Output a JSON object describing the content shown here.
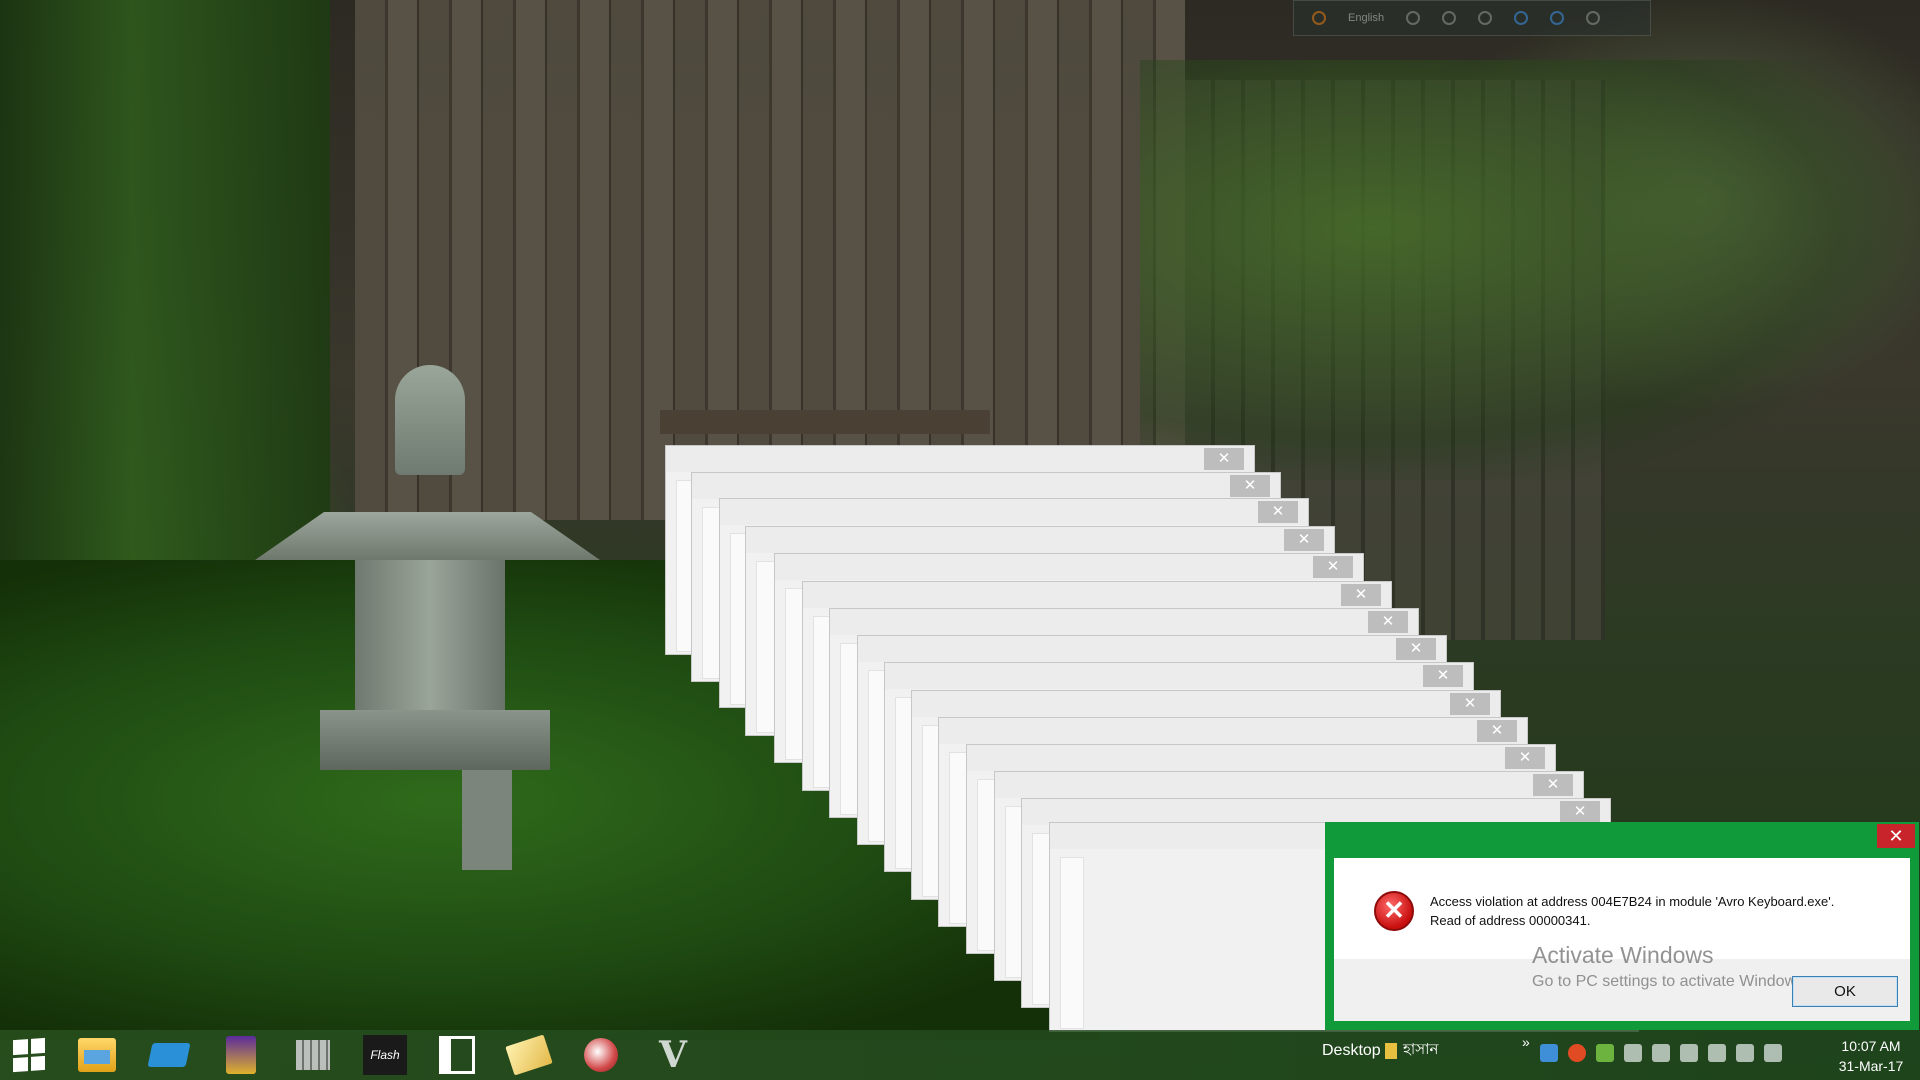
{
  "language_bar": {
    "language": "English",
    "icons": [
      "avro-logo-icon",
      "keyboard-layout-icon",
      "tools-icon",
      "settings-icon",
      "web-icon",
      "help-icon",
      "info-icon"
    ]
  },
  "ghost_dialogs": {
    "close_glyph": "✕",
    "count": 16
  },
  "error_dialog": {
    "close_glyph": "✕",
    "icon": "error-x-icon",
    "icon_glyph": "✕",
    "message_line1": "Access violation at address 004E7B24 in module 'Avro Keyboard.exe'.",
    "message_line2": "Read of address 00000341.",
    "ok_label": "OK",
    "title_color": "#109a3a"
  },
  "watermark": {
    "line1": "Activate Windows",
    "line2": "Go to PC settings to activate Windows."
  },
  "taskbar": {
    "start_icon": "windows-start-icon",
    "pinned": [
      "file-explorer-icon",
      "calculator-icon",
      "dictionary-app-icon",
      "grid-app-icon",
      "flash-icon",
      "reader-app-icon",
      "notepad-pen-icon",
      "magnifier-app-icon",
      "v-app-icon"
    ],
    "flash_label": "Flash",
    "v_label": "V",
    "desktop_label": "Desktop",
    "language_label": "হাসান",
    "overflow": "»",
    "tray_icons": [
      "network-blue-icon",
      "update-icon",
      "nvidia-icon",
      "bluetooth-icon",
      "usb-icon",
      "display-icon",
      "battery-icon",
      "signal-icon",
      "volume-icon"
    ],
    "time": "10:07 AM",
    "date": "31-Mar-17"
  }
}
